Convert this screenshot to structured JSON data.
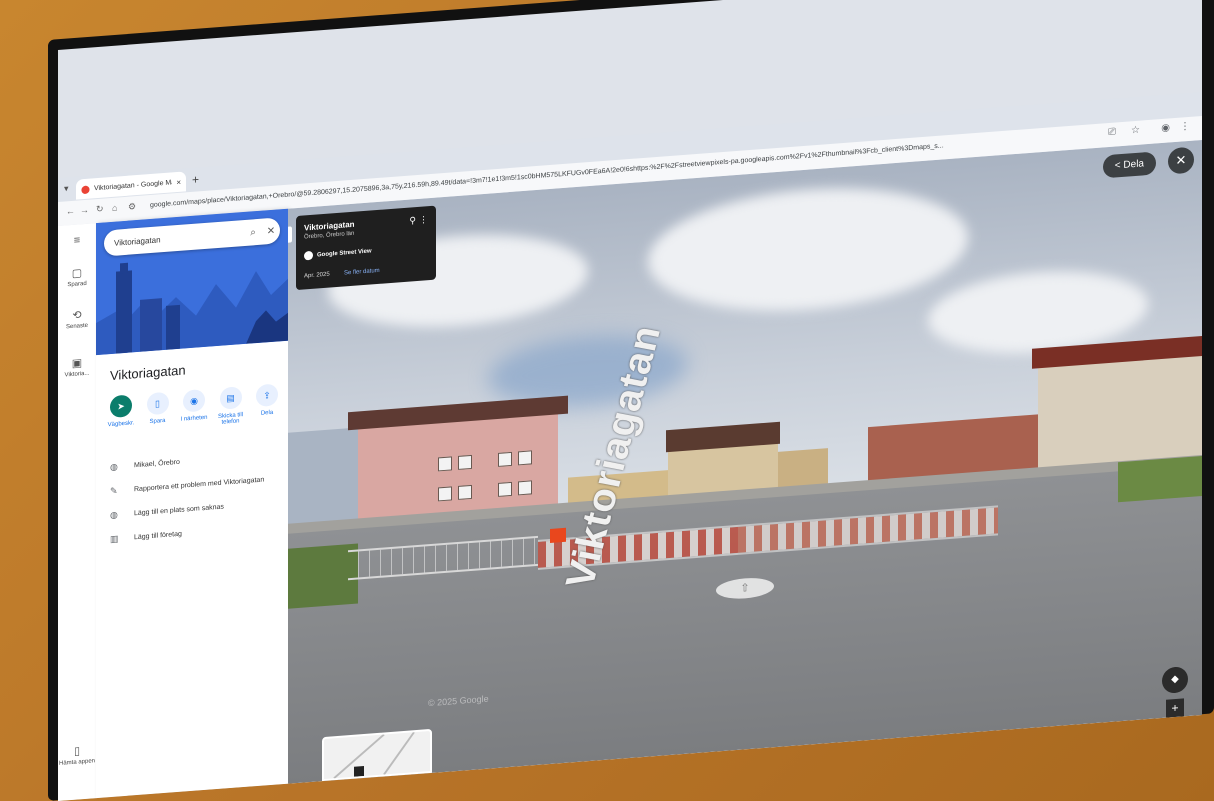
{
  "browser": {
    "tab_title": "Viktoriagatan - Google Maps",
    "new_tab": "+",
    "url": "google.com/maps/place/Viktoriagatan,+Örebro/@59.2806297,15.2075896,3a,75y,216.59h,89.49t/data=!3m7!1e1!3m5!1sc0bHM575LKFUGv0FEa6A!2e0!6shttps:%2F%2Fstreetviewpixels-pa.googleapis.com%2Fv1%2Fthumbnail%3Fcb_client%3Dmaps_s...",
    "min": "–",
    "max": "▢",
    "close": "✕"
  },
  "rail": {
    "items": [
      {
        "icon": "≡",
        "label": ""
      },
      {
        "icon": "▢",
        "label": "Sparad"
      },
      {
        "icon": "⟲",
        "label": "Senaste"
      },
      {
        "icon": "▣",
        "label": "Viktoria..."
      },
      {
        "icon": "▯",
        "label": "Hämta appen"
      }
    ]
  },
  "panel": {
    "search_value": "Viktoriagatan",
    "place_title": "Viktoriagatan",
    "actions": [
      {
        "icon": "➤",
        "label": "Vägbeskr."
      },
      {
        "icon": "▯",
        "label": "Spara"
      },
      {
        "icon": "◉",
        "label": "I närheten"
      },
      {
        "icon": "▤",
        "label": "Skicka till telefon"
      },
      {
        "icon": "⇪",
        "label": "Dela"
      }
    ],
    "info": [
      {
        "icon": "◍",
        "text": "Mikael, Örebro"
      },
      {
        "icon": "✎",
        "text": "Rapportera ett problem med Viktoriagatan"
      },
      {
        "icon": "◍",
        "text": "Lägg till en plats som saknas"
      },
      {
        "icon": "▥",
        "text": "Lägg till företag"
      }
    ]
  },
  "streetview": {
    "card_title": "Viktoriagatan",
    "card_subtitle": "Örebro, Örebro län",
    "card_source": "Google Street View",
    "card_date": "Apr. 2025",
    "card_link": "Se fler datum",
    "share_label": "Dela",
    "street_name": "Viktoriagatan",
    "watermark": "© 2025 Google"
  }
}
